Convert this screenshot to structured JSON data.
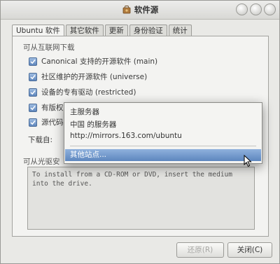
{
  "window": {
    "title": "软件源"
  },
  "tabs": [
    {
      "label": "Ubuntu 软件",
      "active": true
    },
    {
      "label": "其它软件",
      "active": false
    },
    {
      "label": "更新",
      "active": false
    },
    {
      "label": "身份验证",
      "active": false
    },
    {
      "label": "统计",
      "active": false
    }
  ],
  "downloadable": {
    "heading": "可从互联网下载",
    "items": [
      {
        "label": "Canonical 支持的开源软件 (main)",
        "checked": true
      },
      {
        "label": "社区维护的开源软件 (universe)",
        "checked": true
      },
      {
        "label": "设备的专有驱动 (restricted)",
        "checked": true
      },
      {
        "label": "有版权",
        "checked": true
      },
      {
        "label": "源代码",
        "checked": true
      }
    ],
    "download_from_label": "下载自:"
  },
  "cdrom": {
    "heading": "可从光驱安",
    "placeholder": "To install from a CD-ROM or DVD, insert the medium into the drive."
  },
  "server_menu": {
    "items": [
      "主服务器",
      "中国 的服务器",
      "http://mirrors.163.com/ubuntu"
    ],
    "other_label": "其他站点..."
  },
  "buttons": {
    "revert": "还原(R)",
    "close": "关闭(C)"
  },
  "colors": {
    "accent": "#5d86be",
    "checkbox": "#6f93c4"
  }
}
